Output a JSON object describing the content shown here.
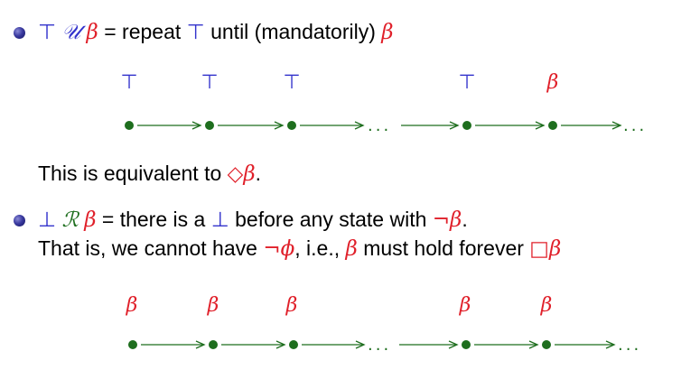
{
  "bullet1": {
    "formula_left": "⊤",
    "formula_op": "𝒰",
    "formula_right": "β",
    "eq_text": " = repeat ",
    "repeat_sym": "⊤",
    "until_text": " until (mandatorily) ",
    "until_sym": "β"
  },
  "diagram1": {
    "labels": [
      "⊤",
      "⊤",
      "⊤",
      "⊤",
      "β"
    ],
    "ellipsis": "...",
    "ellipsis_end": "..."
  },
  "equiv": {
    "text": "This is equivalent to ",
    "diamond": "◇",
    "beta": "β",
    "period": "."
  },
  "bullet2": {
    "formula_left": "⊥",
    "formula_op": "ℛ",
    "formula_right": "β",
    "text1": " = there is a ",
    "bot": "⊥",
    "text2": " before any state with ",
    "neg_beta": "¬β",
    "period": ".",
    "line2_text1": "That is, we cannot have ",
    "neg_phi": "¬ϕ",
    "line2_text2": ", i.e., ",
    "beta": "β",
    "line2_text3": " must hold forever ",
    "box": "□",
    "box_beta": "β"
  },
  "diagram2": {
    "labels": [
      "β",
      "β",
      "β",
      "β",
      "β"
    ],
    "ellipsis": "...",
    "ellipsis_end": "..."
  },
  "colors": {
    "blue": "#3333cc",
    "red": "#e0202a",
    "green": "#1e6e1e"
  }
}
